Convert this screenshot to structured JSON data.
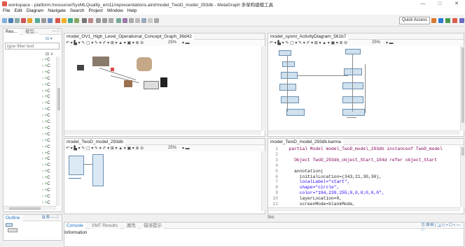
{
  "window": {
    "title": "workspace - platform:/resource/SysMLQuality_em11/representations.aird/model_TwoD_model_293db - MetaGraph 多架构建模工具",
    "minimize": "—",
    "maximize": "□",
    "close": "✕"
  },
  "menu": [
    "File",
    "Edit",
    "Diagram",
    "Navigate",
    "Search",
    "Project",
    "Window",
    "Help"
  ],
  "toolbar": {
    "quick_access": "Quick Access"
  },
  "left_panel": {
    "tab_resources": "Res...",
    "tab_model": "模型...",
    "filter_placeholder": "type filter text",
    "tree_marker": "C",
    "outline_tab": "Outline"
  },
  "editors": {
    "ov1": {
      "tab": "model_OV1_High_Level_Operational_Concept_Graph_36d42",
      "zoom": "25%"
    },
    "activity": {
      "tab": "model_sysml_ActivityDiagram_561b7",
      "zoom": "25%"
    },
    "twod": {
      "tab": "model_TwoD_model_293db",
      "zoom": "25%"
    },
    "karma": {
      "tab": "model_TwoD_model_293db.karma",
      "lines": [
        {
          "n": "1",
          "t": "  partial Model model_TwoD_model_293db instanceof TwoD_model"
        },
        {
          "n": "2",
          "t": ""
        },
        {
          "n": "3",
          "t": "    Object TwoD_293db_object_Start_104d refer object_Start"
        },
        {
          "n": "4",
          "t": ""
        },
        {
          "n": "5",
          "t": "    annotation("
        },
        {
          "n": "6",
          "t": "      initialLocation=(343,21,30,30),"
        },
        {
          "n": "7",
          "t": "      localLabel=\"start\","
        },
        {
          "n": "8",
          "t": "      shape=\"circle\","
        },
        {
          "n": "9",
          "t": "      color=\"194,239,255;0,0,0;0,0,0\","
        },
        {
          "n": "10",
          "t": "      layerLocation=0,"
        },
        {
          "n": "11",
          "t": "      screenMode=blankMode,"
        }
      ]
    }
  },
  "src_tab": "Src",
  "bottom_panel": {
    "tab_console": "Console",
    "tab_smt": "SMT Results",
    "tab_properties": "属性",
    "tab_errors": "错误提示",
    "info": "Information"
  },
  "colors": {
    "accent": "#1e6fc8",
    "background": "#f0f0f0"
  }
}
